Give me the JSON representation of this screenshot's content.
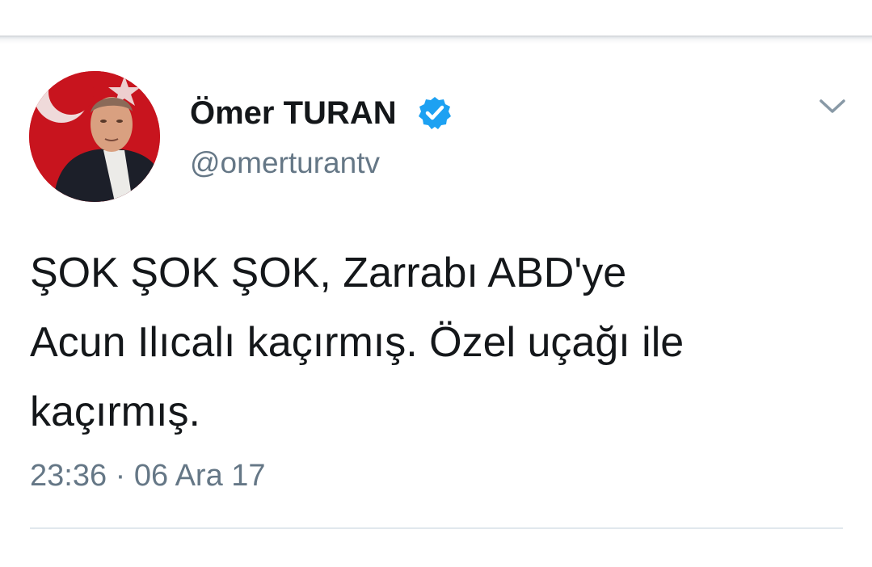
{
  "user": {
    "display_name": "Ömer TURAN",
    "handle": "@omerturantv",
    "verified": true
  },
  "tweet": {
    "text_lines": [
      "ŞOK ŞOK ŞOK, Zarrabı ABD'ye",
      "Acun Ilıcalı kaçırmış. Özel uçağı ile",
      "kaçırmış."
    ],
    "timestamp": "23:36 · 06 Ara 17"
  },
  "icons": {
    "verified": "verified-badge-icon",
    "menu": "chevron-down-icon"
  },
  "colors": {
    "verified_blue": "#1da1f2",
    "text_primary": "#14171a",
    "text_secondary": "#657786",
    "divider": "#e1e8ed"
  }
}
